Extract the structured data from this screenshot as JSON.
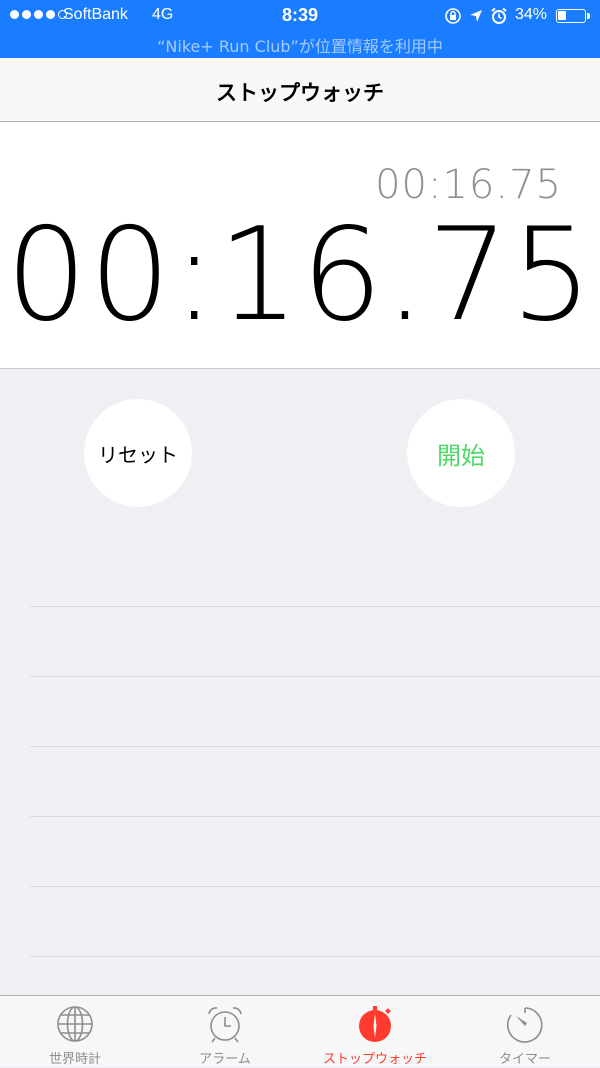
{
  "status_bar": {
    "carrier": "SoftBank",
    "network": "4G",
    "time": "8:39",
    "battery_percent": "34%",
    "battery_level": 0.34,
    "location_banner": "“Nike+ Run Club”が位置情報を利用中",
    "icons": [
      "orientation-lock-icon",
      "location-arrow-icon",
      "alarm-icon",
      "battery-icon"
    ]
  },
  "nav": {
    "title": "ストップウォッチ"
  },
  "stopwatch": {
    "lap_time": "00:16.75",
    "main_time": "00:16.75",
    "reset_label": "リセット",
    "start_label": "開始"
  },
  "colors": {
    "status_bar_bg": "#1a7cff",
    "start_green": "#4cd964",
    "active_tab_red": "#ff3b30",
    "inactive_tab_gray": "#8e8e93"
  },
  "tabs": [
    {
      "label": "世界時計",
      "icon": "globe-icon",
      "active": false
    },
    {
      "label": "アラーム",
      "icon": "alarm-clock-icon",
      "active": false
    },
    {
      "label": "ストップウォッチ",
      "icon": "stopwatch-icon",
      "active": true
    },
    {
      "label": "タイマー",
      "icon": "timer-icon",
      "active": false
    }
  ]
}
